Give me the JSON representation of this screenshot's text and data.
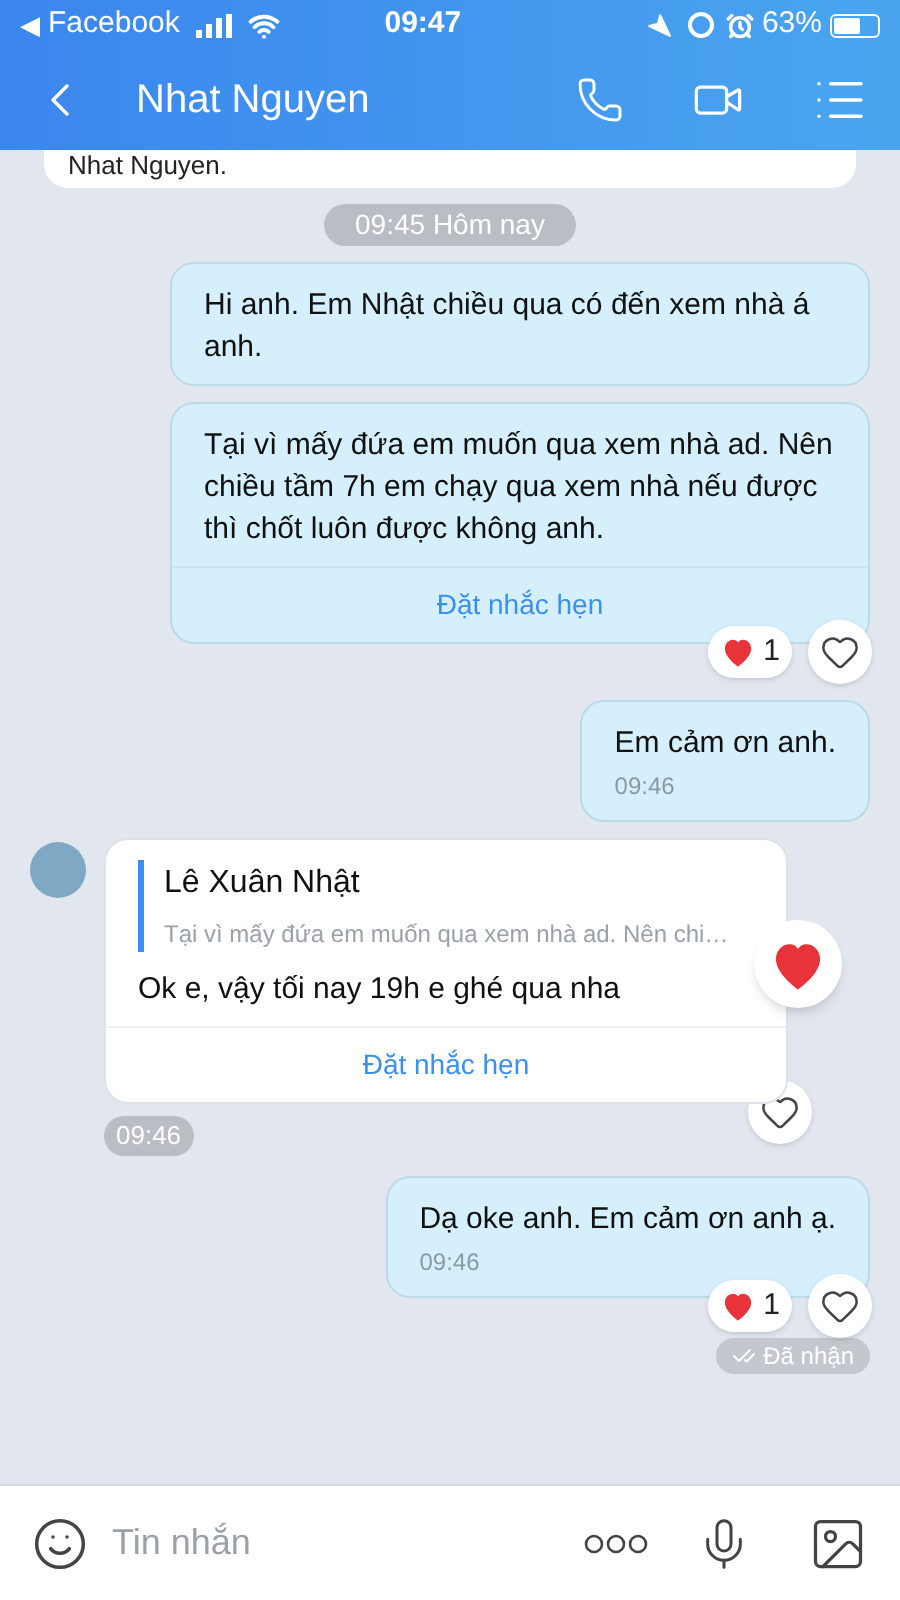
{
  "status_bar": {
    "back_arrow": "◀",
    "back_app": "Facebook",
    "time": "09:47",
    "battery": "63%"
  },
  "header": {
    "title": "Nhat Nguyen"
  },
  "partial_card": {
    "text": "Nhat Nguyen."
  },
  "date_chip": "09:45 Hôm nay",
  "messages": [
    {
      "kind": "sent",
      "text": "Hi anh. Em Nhật chiều qua có đến xem nhà á anh.",
      "like_button": false,
      "big_heart": false
    },
    {
      "kind": "sent",
      "text": "Tại vì mấy đứa em muốn qua xem nhà ad. Nên chiều tầm 7h em chạy qua xem nhà nếu được thì chốt luôn được không anh.",
      "reminder": "Đặt nhắc hẹn",
      "reaction": {
        "count": "1"
      },
      "like_button": true,
      "big_heart": false
    },
    {
      "kind": "sent",
      "text": "Em cảm ơn anh.",
      "time": "09:46",
      "like_button": false,
      "big_heart": false
    },
    {
      "kind": "received",
      "quote": {
        "author": "Lê Xuân Nhật",
        "text": "Tại vì mấy đứa em muốn qua xem nhà ad. Nên chi…"
      },
      "text": "Ok e, vậy tối nay 19h e ghé qua nha",
      "reminder": "Đặt nhắc hẹn",
      "time": "09:46",
      "like_button": true,
      "big_heart": true
    },
    {
      "kind": "sent",
      "text": "Dạ oke anh. Em cảm ơn anh ạ.",
      "time": "09:46",
      "reaction": {
        "count": "1"
      },
      "like_button": true,
      "big_heart": false
    }
  ],
  "receipt": "Đã nhận",
  "composer": {
    "placeholder": "Tin nhắn"
  }
}
